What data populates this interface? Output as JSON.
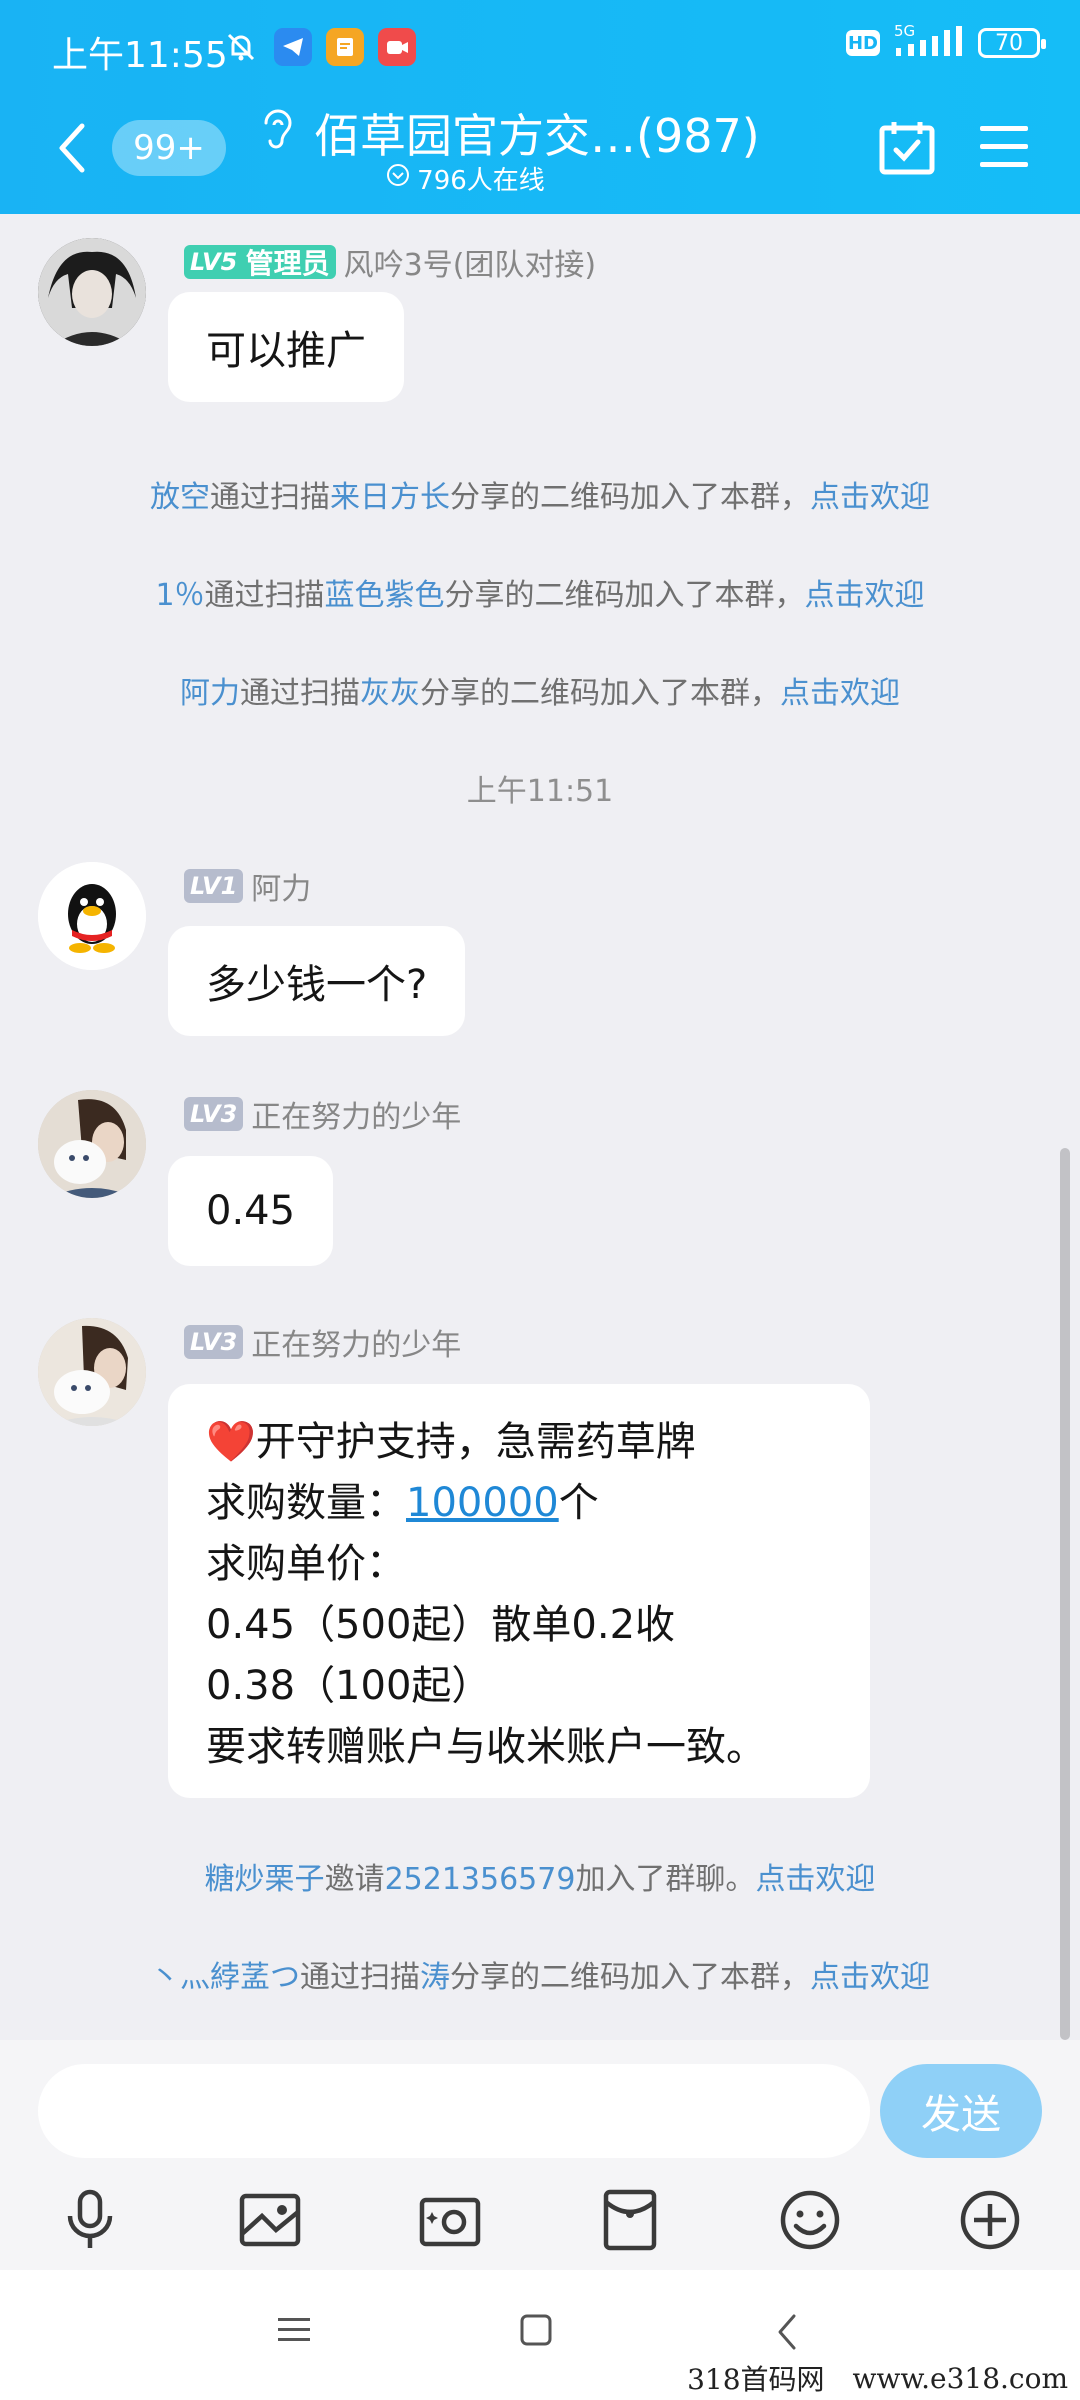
{
  "status_bar": {
    "time": "上午11:55",
    "network": "5G",
    "battery": "70",
    "hd_badge": "HD"
  },
  "header": {
    "unread_count": "99+",
    "title": "佰草园官方交…(987)",
    "online": "796人在线"
  },
  "messages": [
    {
      "type": "chat",
      "level": "LV5",
      "role_badge": "管理员",
      "sender": "风吟3号(团队对接)",
      "text": "可以推广"
    },
    {
      "type": "system",
      "parts": [
        {
          "t": "放空",
          "blue": true
        },
        {
          "t": "通过扫描",
          "blue": false
        },
        {
          "t": "来日方长",
          "blue": true
        },
        {
          "t": "分享的二维码加入了本群，",
          "blue": false
        },
        {
          "t": "点击欢迎",
          "blue": true
        }
      ]
    },
    {
      "type": "system",
      "parts": [
        {
          "t": "1％",
          "blue": true
        },
        {
          "t": "通过扫描",
          "blue": false
        },
        {
          "t": "蓝色紫色",
          "blue": true
        },
        {
          "t": "分享的二维码加入了本群，",
          "blue": false
        },
        {
          "t": "点击欢迎",
          "blue": true
        }
      ]
    },
    {
      "type": "system",
      "parts": [
        {
          "t": "阿力",
          "blue": true
        },
        {
          "t": "通过扫描",
          "blue": false
        },
        {
          "t": "灰灰",
          "blue": true
        },
        {
          "t": "分享的二维码加入了本群，",
          "blue": false
        },
        {
          "t": "点击欢迎",
          "blue": true
        }
      ]
    },
    {
      "type": "time",
      "text": "上午11:51"
    },
    {
      "type": "chat",
      "level": "LV1",
      "sender": "阿力",
      "text": "多少钱一个?"
    },
    {
      "type": "chat",
      "level": "LV3",
      "sender": "正在努力的少年",
      "text": "0.45"
    },
    {
      "type": "chat",
      "level": "LV3",
      "sender": "正在努力的少年",
      "lines": [
        "❤️开守护支持，急需药草牌",
        "求购数量：",
        "求购单价：",
        "0.45（500起）散单0.2收",
        "0.38（100起）",
        "要求转赠账户与收米账户一致。"
      ],
      "quantity_link": "100000",
      "quantity_unit": "个"
    },
    {
      "type": "system",
      "parts": [
        {
          "t": "糖炒栗子",
          "blue": true
        },
        {
          "t": "邀请",
          "blue": false
        },
        {
          "t": "2521356579",
          "blue": true
        },
        {
          "t": "加入了群聊。",
          "blue": false
        },
        {
          "t": "点击欢迎",
          "blue": true
        }
      ]
    },
    {
      "type": "system",
      "parts": [
        {
          "t": "丶灬綍䓝つ",
          "blue": true
        },
        {
          "t": "通过扫描",
          "blue": false
        },
        {
          "t": "涛",
          "blue": true
        },
        {
          "t": "分享的二维码加入了本群，",
          "blue": false
        },
        {
          "t": "点击欢迎",
          "blue": true
        }
      ]
    }
  ],
  "composer": {
    "send_label": "发送"
  },
  "watermark": {
    "left": "318首码网",
    "right": "www.e318.com"
  }
}
